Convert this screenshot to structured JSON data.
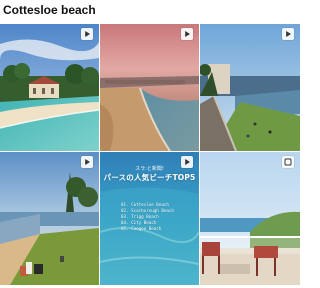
{
  "page": {
    "title": "Cottesloe beach"
  },
  "tiles": [
    {
      "name": "video-tile-1",
      "alt": "Cottesloe beach pavilion with turquoise water and sandy shore",
      "icon": "play-icon"
    },
    {
      "name": "video-tile-2",
      "alt": "Aerial view of beach coastline at sunset with pink sky",
      "icon": "play-icon"
    },
    {
      "name": "video-tile-3",
      "alt": "Coastal walkway with grassy lawn and people beside the ocean",
      "icon": "play-icon"
    },
    {
      "name": "video-tile-4",
      "alt": "People sitting on grassy slope overlooking beach at sunset",
      "icon": "play-icon"
    },
    {
      "name": "video-tile-5",
      "alt": "Underwater-style ocean image with top five beaches list",
      "icon": "play-icon"
    },
    {
      "name": "video-tile-6",
      "alt": "Balcony with red chairs and table overlooking the sea",
      "icon": "checkbox-icon"
    }
  ],
  "overlay": {
    "kicker": "スラ:と新聞!",
    "heading": "パースの人気ビーチTOP5",
    "items": [
      "01. Cottesloe Beach",
      "02. Scarborough Beach",
      "03. Trigg Beach",
      "04. City Beach",
      "05. Coogee Beach"
    ]
  },
  "colors": {
    "tile_icon_bg": "#ffffff",
    "tile_icon_fg": "#333333"
  }
}
